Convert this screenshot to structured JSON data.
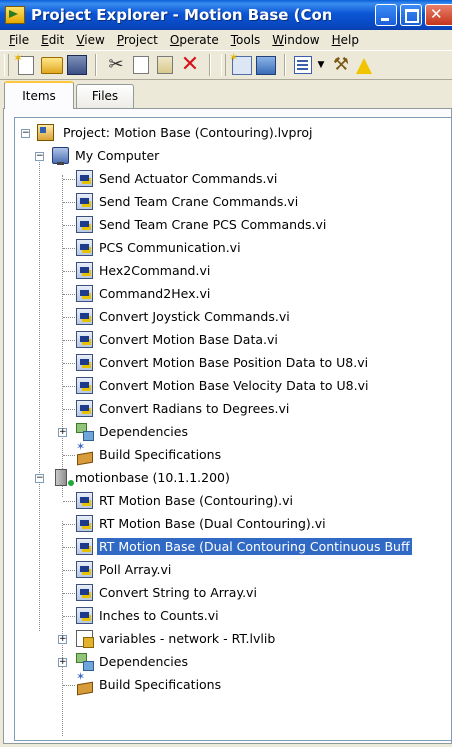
{
  "window": {
    "title": "Project Explorer - Motion Base (Cont...",
    "min_icon": "minimize-icon",
    "max_icon": "maximize-icon",
    "close_icon": "close-icon"
  },
  "menu": [
    {
      "accel": "F",
      "rest": "ile"
    },
    {
      "accel": "E",
      "rest": "dit"
    },
    {
      "accel": "V",
      "rest": "iew"
    },
    {
      "accel": "P",
      "rest": "roject"
    },
    {
      "accel": "O",
      "rest": "perate"
    },
    {
      "accel": "T",
      "rest": "ools"
    },
    {
      "accel": "W",
      "rest": "indow"
    },
    {
      "accel": "H",
      "rest": "elp"
    }
  ],
  "tabs": {
    "items": "Items",
    "files": "Files"
  },
  "tree": {
    "project": "Project: Motion Base (Contouring).lvproj",
    "my_computer": "My Computer",
    "mc_items": [
      "Send Actuator Commands.vi",
      "Send Team Crane Commands.vi",
      "Send Team Crane PCS Commands.vi",
      "PCS Communication.vi",
      "Hex2Command.vi",
      "Command2Hex.vi",
      "Convert Joystick Commands.vi",
      "Convert Motion Base Data.vi",
      "Convert Motion Base Position Data to U8.vi",
      "Convert Motion Base Velocity Data to U8.vi",
      "Convert Radians to Degrees.vi"
    ],
    "mc_dependencies": "Dependencies",
    "mc_build": "Build Specifications",
    "target": "motionbase (10.1.1.200)",
    "target_items": [
      "RT Motion Base (Contouring).vi",
      "RT Motion Base (Dual Contouring).vi",
      "RT Motion Base (Dual Contouring Continuous Buff",
      "Poll Array.vi",
      "Convert String to Array.vi",
      "Inches to Counts.vi"
    ],
    "target_lib": "variables - network - RT.lvlib",
    "target_dependencies": "Dependencies",
    "target_build": "Build Specifications"
  }
}
